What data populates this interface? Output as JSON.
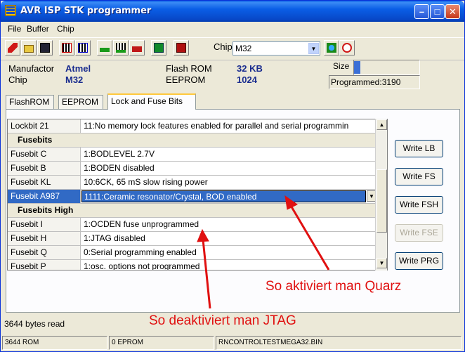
{
  "window": {
    "title": "AVR ISP STK programmer"
  },
  "menu": [
    {
      "label": "File"
    },
    {
      "label": "Buffer"
    },
    {
      "label": "Chip"
    }
  ],
  "toolbar": {
    "chip_label": "Chip",
    "chip_value": "M32"
  },
  "info": {
    "manufacturer_label": "Manufactor",
    "manufacturer_value": "Atmel",
    "chip_label": "Chip",
    "chip_value": "M32",
    "flash_label": "Flash ROM",
    "flash_value": "32 KB",
    "eeprom_label": "EEPROM",
    "eeprom_value": "1024",
    "size_label": "Size",
    "size_fraction": 0.1,
    "programmed_text": "Programmed:3190"
  },
  "tabs": [
    {
      "label": "FlashROM"
    },
    {
      "label": "EEPROM"
    },
    {
      "label": "Lock and Fuse Bits"
    }
  ],
  "grid": {
    "row0": {
      "name": "Lockbit 21",
      "value": "11:No memory lock features enabled for parallel and serial programmin"
    },
    "section_fusebits": "Fusebits",
    "row1": {
      "name": "Fusebit C",
      "value": "1:BODLEVEL 2.7V"
    },
    "row2": {
      "name": "Fusebit B",
      "value": "1:BODEN disabled"
    },
    "row3": {
      "name": "Fusebit KL",
      "value": "10:6CK, 65 mS slow rising power"
    },
    "row4": {
      "name": "Fusebit A987",
      "value": "1111:Ceramic resonator/Crystal, BOD enabled"
    },
    "section_high": "Fusebits High",
    "row5": {
      "name": "Fusebit I",
      "value": "1:OCDEN fuse unprogrammed"
    },
    "row6": {
      "name": "Fusebit H",
      "value": "1:JTAG disabled"
    },
    "row7": {
      "name": "Fusebit Q",
      "value": "0:Serial programming enabled"
    },
    "row8": {
      "name": "Fusebit P",
      "value": "1:osc. options not programmed"
    }
  },
  "buttons": {
    "write_lb": "Write LB",
    "write_fs": "Write FS",
    "write_fsh": "Write FSH",
    "write_fse": "Write FSE",
    "write_prg": "Write PRG"
  },
  "annotations": {
    "quarz": "So aktiviert man Quarz",
    "jtag": "So deaktiviert man JTAG",
    "color": "#e01010"
  },
  "status": {
    "bytes_read": "3644 bytes read",
    "rom": "3644 ROM",
    "eprom": "0 EPROM",
    "file": "RNCONTROLTESTMEGA32.BIN"
  }
}
